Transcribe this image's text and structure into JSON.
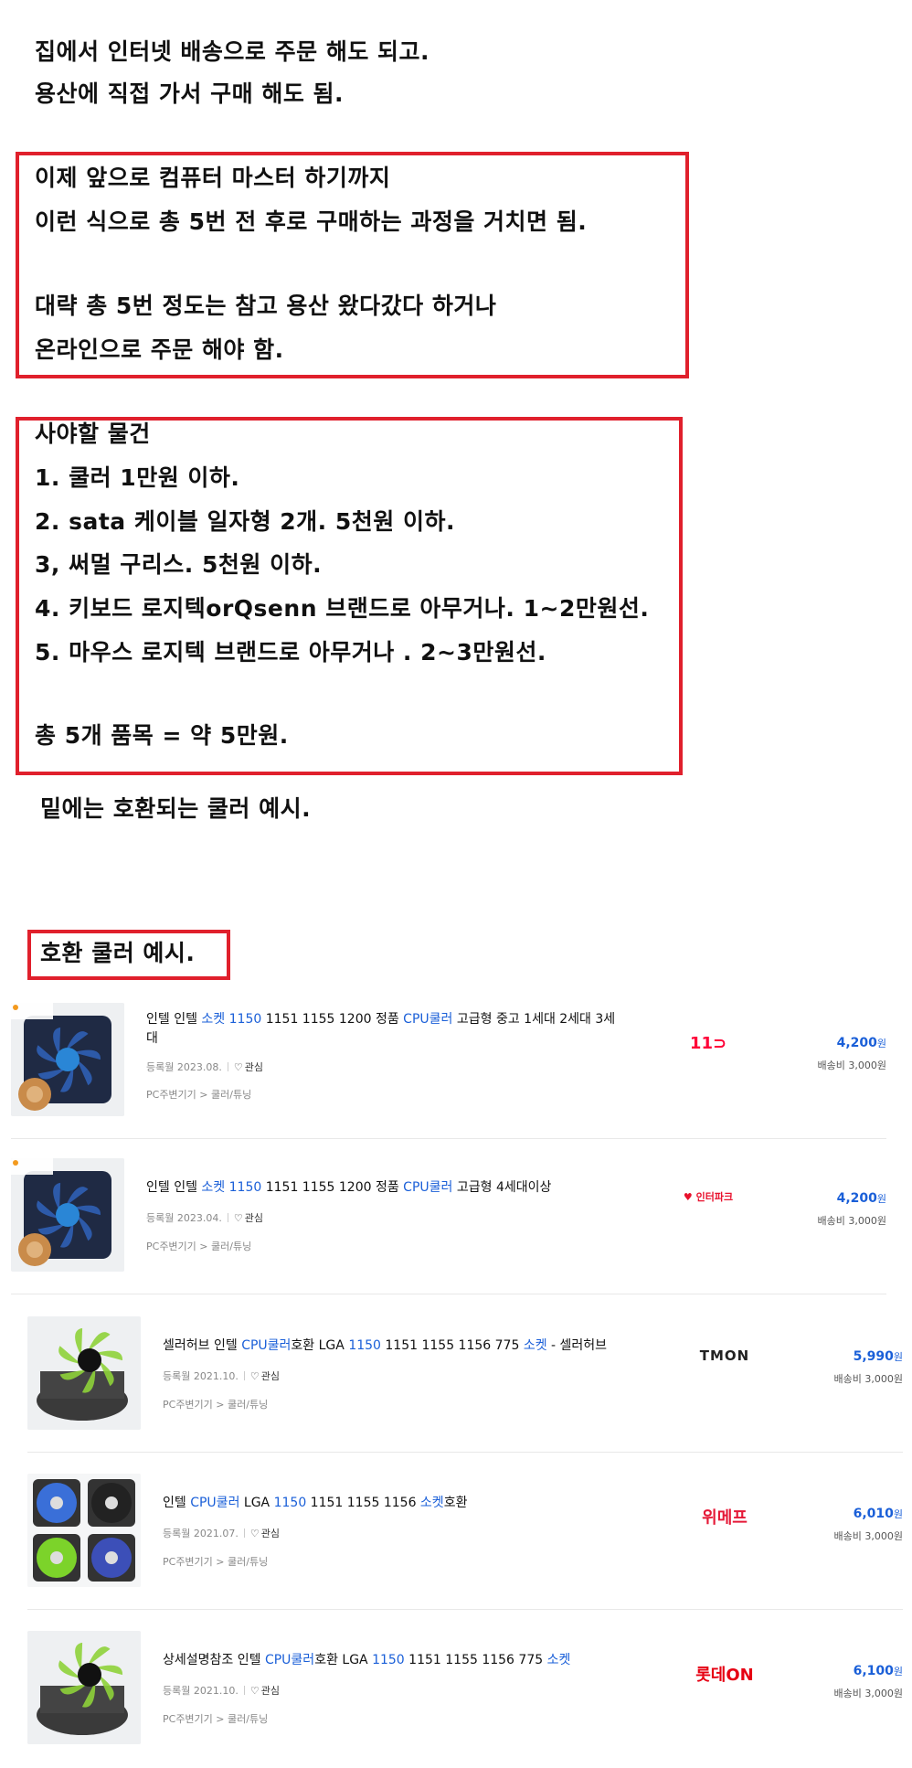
{
  "intro": {
    "line1": "집에서 인터넷 배송으로 주문 해도 되고.",
    "line2": "용산에 직접 가서 구매 해도 됨."
  },
  "box1": {
    "line1": "이제 앞으로 컴퓨터 마스터 하기까지",
    "line2": "이런 식으로 총 5번 전 후로 구매하는 과정을 거치면 됨.",
    "line3": "대략 총 5번 정도는 참고 용산 왔다갔다 하거나",
    "line4": "온라인으로 주문 해야 함."
  },
  "box2": {
    "heading": "사야할 물건",
    "item1": "1. 쿨러 1만원 이하.",
    "item2": "2. sata 케이블 일자형 2개. 5천원 이하.",
    "item3": "3, 써멀 구리스. 5천원 이하.",
    "item4": "4. 키보드 로지텍orQsenn 브랜드로 아무거나. 1~2만원선.",
    "item5": "5. 마우스 로지텍 브랜드로 아무거나 . 2~3만원선.",
    "total": "총 5개 품목 = 약 5만원."
  },
  "below_note": "밑에는 호환되는 쿨러 예시.",
  "section_title": "호환 쿨러 예시.",
  "products": [
    {
      "title_parts": [
        "인텔 인텔 ",
        "소켓 1150",
        " 1151 1155 1200 정품 ",
        "CPU쿨러",
        " 고급형 중고 1세대 2세대 3세"
      ],
      "title_line2": "대",
      "date": "등록월 2023.08.",
      "zzim": "관심",
      "category": "PC주변기기 > 쿨러/튜닝",
      "mall": "11번가",
      "mall_logo": "11⊃",
      "price": "4,200",
      "won": "원",
      "shipping": "배송비 3,000원",
      "mall_color": "#ff0038"
    },
    {
      "title_parts": [
        "인텔 인텔 ",
        "소켓 1150",
        " 1151 1155 1200 정품 ",
        "CPU쿨러",
        " 고급형 4세대이상"
      ],
      "title_line2": "",
      "date": "등록월 2023.04.",
      "zzim": "관심",
      "category": "PC주변기기 > 쿨러/튜닝",
      "mall": "인터파크",
      "mall_logo": "♥ 인터파크",
      "price": "4,200",
      "won": "원",
      "shipping": "배송비 3,000원",
      "mall_color": "#e8112d"
    },
    {
      "title_parts": [
        "셀러허브 인텔 ",
        "CPU쿨러",
        "호환 LGA ",
        "1150",
        " 1151 1155 1156 775 ",
        "소켓",
        " - 셀러허브"
      ],
      "title_line2": "",
      "date": "등록월 2021.10.",
      "zzim": "관심",
      "category": "PC주변기기 > 쿨러/튜닝",
      "mall": "TMON",
      "mall_logo": "TMON",
      "price": "5,990",
      "won": "원",
      "shipping": "배송비 3,000원",
      "mall_color": "#222222"
    },
    {
      "title_parts": [
        "인텔 ",
        "CPU쿨러",
        " LGA ",
        "1150",
        " 1151 1155 1156 ",
        "소켓",
        "호환"
      ],
      "title_line2": "",
      "date": "등록월 2021.07.",
      "zzim": "관심",
      "category": "PC주변기기 > 쿨러/튜닝",
      "mall": "위메프",
      "mall_logo": "위메프",
      "price": "6,010",
      "won": "원",
      "shipping": "배송비 3,000원",
      "mall_color": "#e51937"
    },
    {
      "title_parts": [
        "상세설명참조 인텔 ",
        "CPU쿨러",
        "호환 LGA ",
        "1150",
        " 1151 1155 1156 775 ",
        "소켓"
      ],
      "title_line2": "",
      "date": "등록월 2021.10.",
      "zzim": "관심",
      "category": "PC주변기기 > 쿨러/튜닝",
      "mall": "롯데ON",
      "mall_logo": "롯데ON",
      "price": "6,100",
      "won": "원",
      "shipping": "배송비 3,000원",
      "mall_color": "#e60012"
    }
  ],
  "colors": {
    "box_border": "#e0202c",
    "highlight": "#1a5fd8"
  }
}
